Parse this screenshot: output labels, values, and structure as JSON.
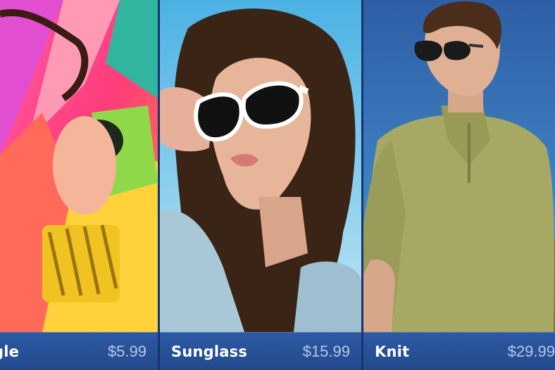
{
  "products": [
    {
      "name": "gle",
      "price": "$5.99"
    },
    {
      "name": "Sunglass",
      "price": "$15.99"
    },
    {
      "name": "Knit",
      "price": "$29.99"
    }
  ],
  "colors": {
    "caption_bar": "#23498c",
    "caption_text": "#ffffff",
    "price_text": "#b6c7e6",
    "accent_pink": "#ff2f8f",
    "sky": "#2f9ad6",
    "knit_green": "#a6a864"
  }
}
